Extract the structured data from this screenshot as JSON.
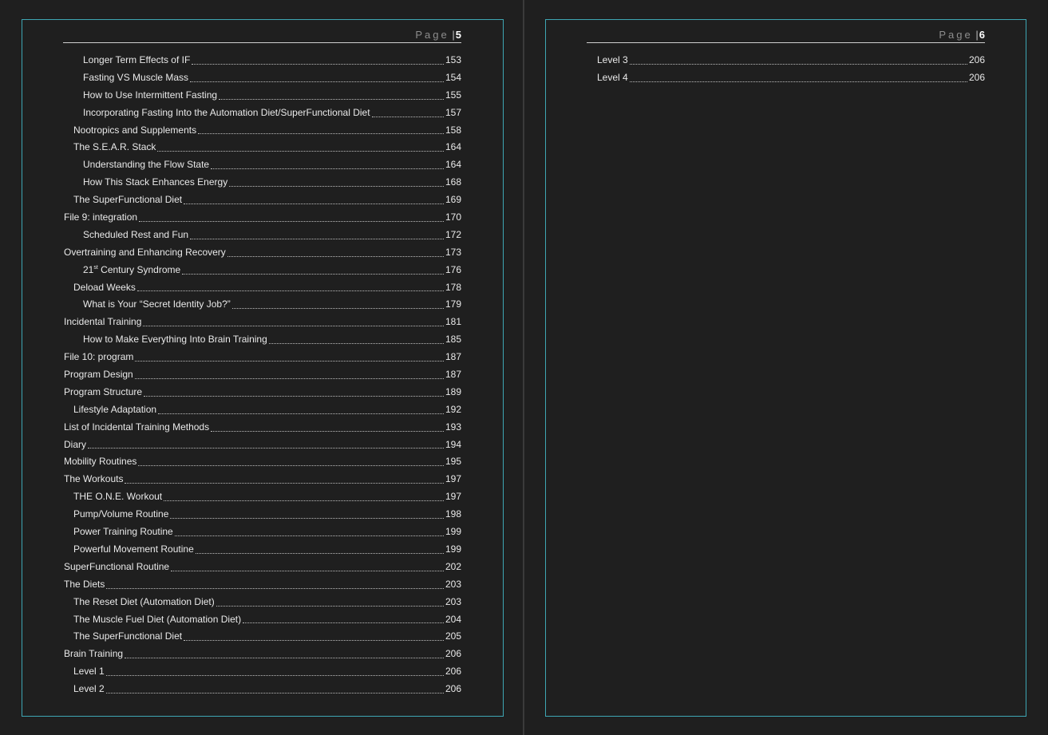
{
  "left_page": {
    "header": {
      "word": "Page",
      "bar": "|",
      "number": "5"
    },
    "entries": [
      {
        "level": 3,
        "title": "Longer Term Effects of IF",
        "page": "153"
      },
      {
        "level": 3,
        "title": "Fasting VS Muscle Mass",
        "page": "154"
      },
      {
        "level": 3,
        "title": "How to Use Intermittent Fasting",
        "page": "155"
      },
      {
        "level": 3,
        "title": "Incorporating Fasting Into the Automation Diet/SuperFunctional Diet",
        "page": "157"
      },
      {
        "level": 2,
        "title": "Nootropics and Supplements",
        "page": "158"
      },
      {
        "level": 2,
        "title": "The S.E.A.R. Stack",
        "page": "164"
      },
      {
        "level": 3,
        "title": "Understanding the Flow State",
        "page": "164"
      },
      {
        "level": 3,
        "title": "How This Stack Enhances Energy",
        "page": "168"
      },
      {
        "level": 2,
        "title": "The SuperFunctional Diet",
        "page": "169"
      },
      {
        "level": 1,
        "title": "File 9: integration",
        "page": "170"
      },
      {
        "level": 3,
        "title": "Scheduled Rest and Fun",
        "page": "172"
      },
      {
        "level": 1,
        "title": "Overtraining and Enhancing Recovery",
        "page": "173"
      },
      {
        "level": 3,
        "title": "21",
        "sup": "st",
        "title_rest": " Century Syndrome",
        "page": "176"
      },
      {
        "level": 2,
        "title": "Deload Weeks",
        "page": "178"
      },
      {
        "level": 3,
        "title": "What is Your “Secret Identity Job?”",
        "page": "179"
      },
      {
        "level": 1,
        "title": "Incidental Training",
        "page": "181"
      },
      {
        "level": 3,
        "title": "How to Make Everything Into Brain Training",
        "page": "185"
      },
      {
        "level": 1,
        "title": "File 10: program",
        "page": "187"
      },
      {
        "level": 1,
        "title": "Program Design",
        "page": "187"
      },
      {
        "level": 1,
        "title": "Program Structure",
        "page": "189"
      },
      {
        "level": 2,
        "title": "Lifestyle Adaptation",
        "page": "192"
      },
      {
        "level": 1,
        "title": "List of Incidental Training Methods",
        "page": "193"
      },
      {
        "level": 1,
        "title": "Diary",
        "page": "194"
      },
      {
        "level": 1,
        "title": "Mobility Routines",
        "page": "195"
      },
      {
        "level": 1,
        "title": "The Workouts",
        "page": "197"
      },
      {
        "level": 2,
        "title": "THE O.N.E. Workout",
        "page": "197"
      },
      {
        "level": 2,
        "title": "Pump/Volume Routine",
        "page": "198"
      },
      {
        "level": 2,
        "title": "Power Training Routine",
        "page": "199"
      },
      {
        "level": 2,
        "title": "Powerful Movement Routine",
        "page": "199"
      },
      {
        "level": 1,
        "title": "SuperFunctional Routine",
        "page": "202"
      },
      {
        "level": 1,
        "title": "The Diets",
        "page": "203"
      },
      {
        "level": 2,
        "title": "The Reset Diet (Automation Diet)",
        "page": "203"
      },
      {
        "level": 2,
        "title": "The Muscle Fuel Diet (Automation Diet)",
        "page": "204"
      },
      {
        "level": 2,
        "title": "The SuperFunctional Diet",
        "page": "205"
      },
      {
        "level": 1,
        "title": "Brain Training",
        "page": "206"
      },
      {
        "level": 2,
        "title": "Level 1",
        "page": "206"
      },
      {
        "level": 2,
        "title": "Level 2",
        "page": "206"
      }
    ]
  },
  "right_page": {
    "header": {
      "word": "Page",
      "bar": "|",
      "number": "6"
    },
    "entries": [
      {
        "level": 2,
        "title": "Level 3",
        "page": "206"
      },
      {
        "level": 2,
        "title": "Level 4",
        "page": "206"
      }
    ]
  },
  "colors": {
    "background": "#1f1f1f",
    "frame": "#3ea6b3",
    "text": "#e9e9e9",
    "header_word": "#8d8d8d"
  }
}
